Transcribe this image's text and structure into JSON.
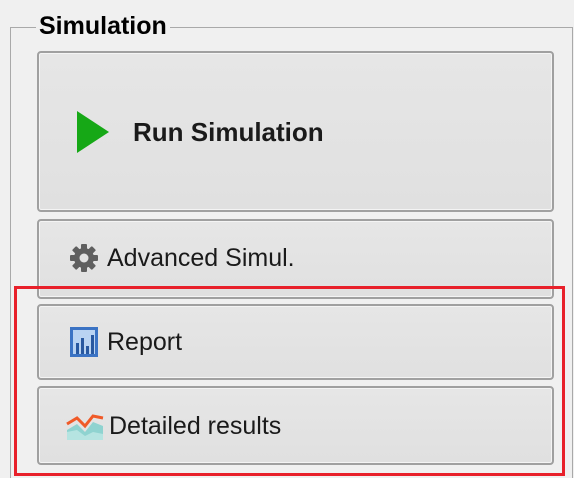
{
  "group": {
    "title": "Simulation"
  },
  "buttons": {
    "run": {
      "label": "Run Simulation",
      "icon": "play-icon"
    },
    "advanced": {
      "label": "Advanced Simul.",
      "icon": "gear-icon"
    },
    "report": {
      "label": "Report",
      "icon": "report-chart-icon"
    },
    "detailed": {
      "label": "Detailed results",
      "icon": "area-chart-icon"
    }
  },
  "colors": {
    "play": "#16a816",
    "highlight": "#e8202a",
    "report_icon": "#3b73c4",
    "chart_fill": "#8fd3d0",
    "chart_line": "#f05a28"
  }
}
